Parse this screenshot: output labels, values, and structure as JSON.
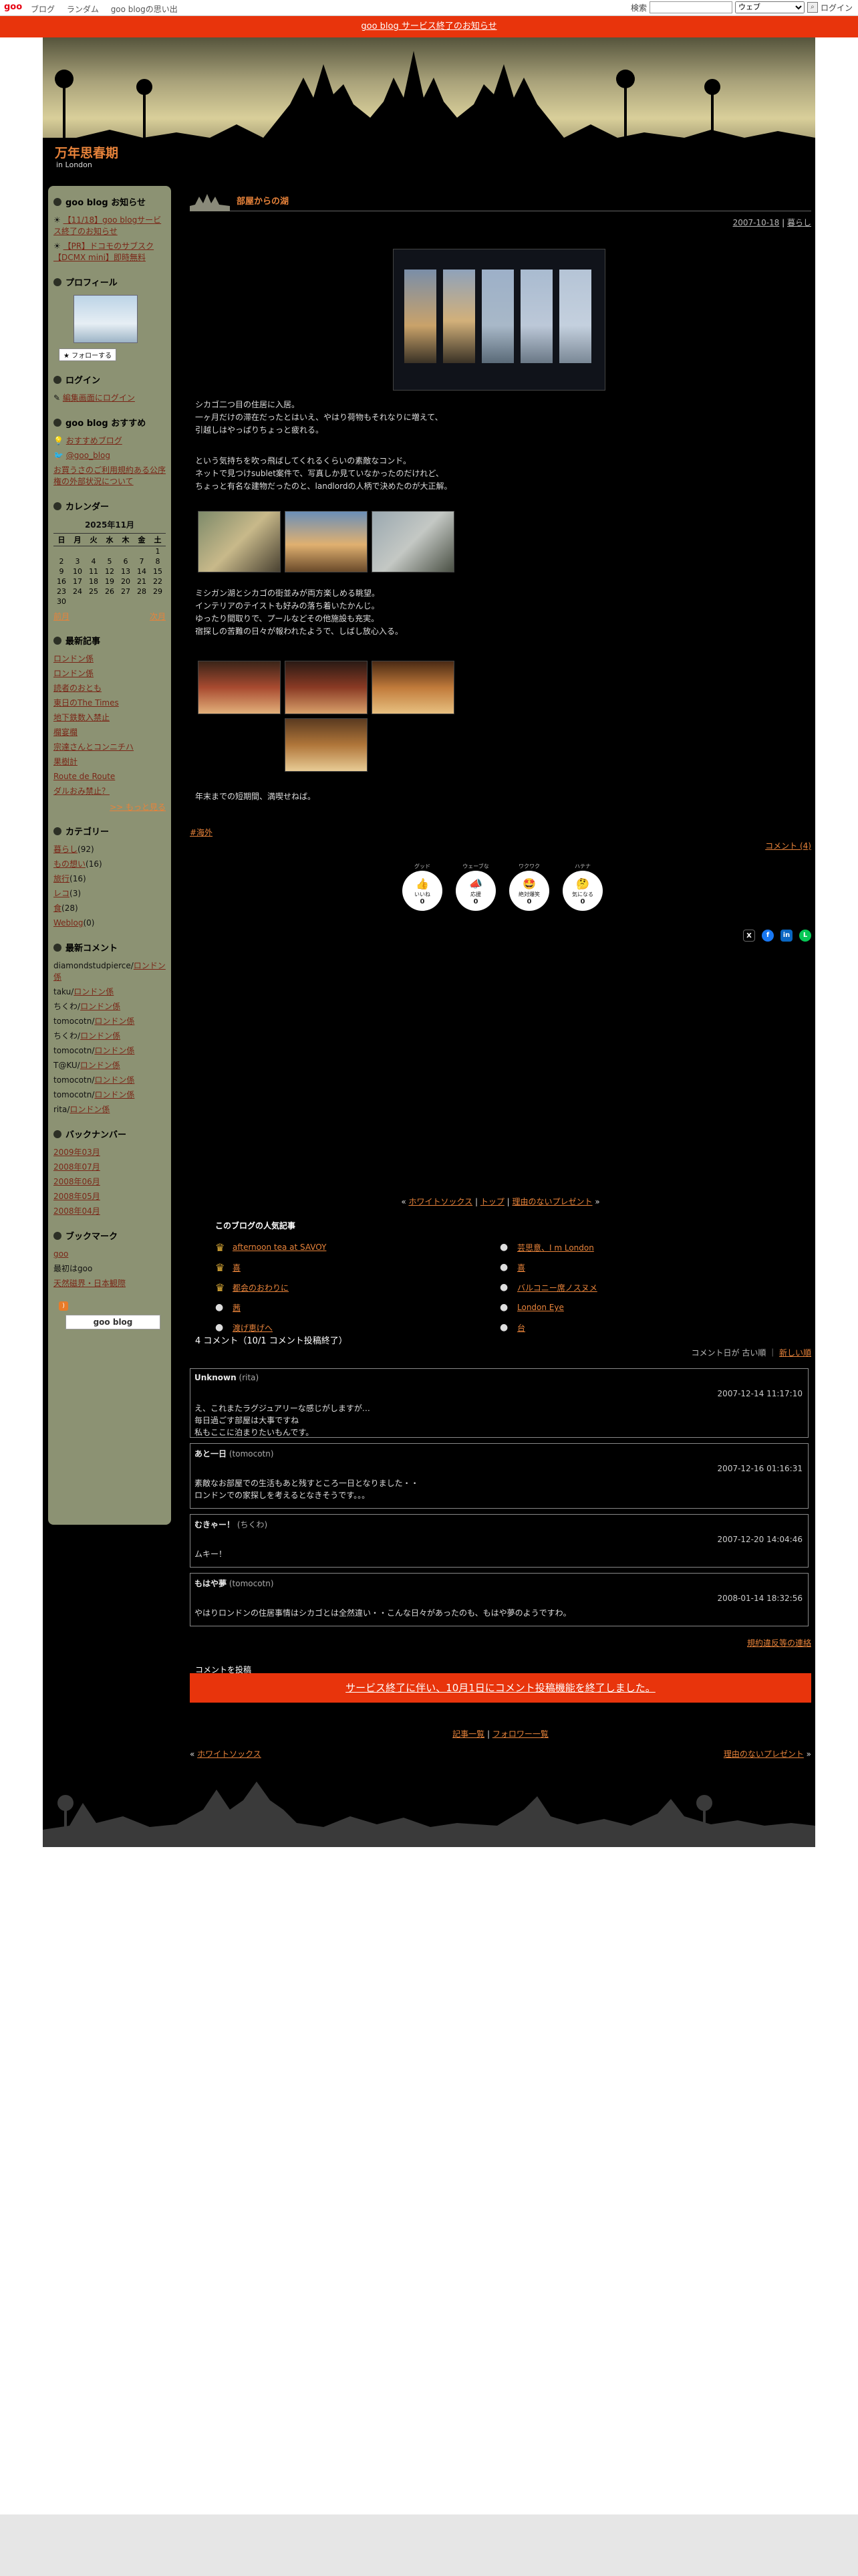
{
  "topbar": {
    "logo": "goo",
    "nav": [
      "ブログ",
      "ランダム",
      "goo blogの思い出"
    ],
    "search_label": "検索",
    "search_select": "ウェブ",
    "login": "ログイン"
  },
  "notice": "goo blog サービス終了のお知らせ",
  "blog": {
    "title": "万年思春期",
    "subtitle": "in London"
  },
  "sidebar": {
    "notice_h": "goo blog お知らせ",
    "notice_items": [
      "【11/18】goo blogサービス終了のお知らせ",
      "【PR】ドコモのサブスク【DCMX mini】即時無料"
    ],
    "profile_h": "プロフィール",
    "follow": "フォローする",
    "login_h": "ログイン",
    "login_link": "編集画面にログイン",
    "rec_h": "goo blog おすすめ",
    "rec_link": "おすすめブログ",
    "goo_blog_link": "@goo_blog",
    "rec_text": "お買うさのご利用規約ある公序権の外部状況について",
    "cal_h": "カレンダー",
    "cal_title": "2025年11月",
    "cal_days": [
      "日",
      "月",
      "火",
      "水",
      "木",
      "金",
      "土"
    ],
    "cal_rows": [
      [
        "",
        "",
        "",
        "",
        "",
        "",
        "1"
      ],
      [
        "2",
        "3",
        "4",
        "5",
        "6",
        "7",
        "8"
      ],
      [
        "9",
        "10",
        "11",
        "12",
        "13",
        "14",
        "15"
      ],
      [
        "16",
        "17",
        "18",
        "19",
        "20",
        "21",
        "22"
      ],
      [
        "23",
        "24",
        "25",
        "26",
        "27",
        "28",
        "29"
      ],
      [
        "30",
        "",
        "",
        "",
        "",
        "",
        ""
      ]
    ],
    "cal_prev": "前月",
    "cal_next": "次月",
    "recent_h": "最新記事",
    "recent_items": [
      "ロンドン係",
      "ロンドン係",
      "読者のおとも",
      "東日のThe Times",
      "地下鉄数入禁止",
      "欄宴欄",
      "宗達さんとコンニチハ",
      "果樹計",
      "Route de Route",
      "ダルおみ禁止？"
    ],
    "more": ">> もっと見る",
    "cat_h": "カテゴリー",
    "categories": [
      [
        "暮らし",
        "(92)"
      ],
      [
        "もの想い",
        "(16)"
      ],
      [
        "旅行",
        "(16)"
      ],
      [
        "レコ",
        "(3)"
      ],
      [
        "食",
        "(28)"
      ],
      [
        "Weblog",
        "(0)"
      ]
    ],
    "comments_h": "最新コメント",
    "comments": [
      [
        "diamondstudpierce",
        "ロンドン係"
      ],
      [
        "taku",
        "ロンドン係"
      ],
      [
        "ちくわ",
        "ロンドン係"
      ],
      [
        "tomocotn",
        "ロンドン係"
      ],
      [
        "ちくわ",
        "ロンドン係"
      ],
      [
        "tomocotn",
        "ロンドン係"
      ],
      [
        "T@KU",
        "ロンドン係"
      ],
      [
        "tomocotn",
        "ロンドン係"
      ],
      [
        "tomocotn",
        "ロンドン係"
      ],
      [
        "rita",
        "ロンドン係"
      ]
    ],
    "backnum_h": "バックナンバー",
    "backnums": [
      "2009年03月",
      "2008年07月",
      "2008年06月",
      "2008年05月",
      "2008年04月"
    ],
    "bookmark_h": "ブックマーク",
    "bookmarks": [
      "goo",
      "最初はgoo",
      "天然磁界・日本観際"
    ],
    "goo_badge": "goo blog"
  },
  "post": {
    "title": "部屋からの湖",
    "date": "2007-10-18",
    "category_link": "暮らし",
    "para1": "シカゴ二つ目の住居に入居。\n一ヶ月だけの滞在だったとはいえ、やはり荷物もそれなりに増えて、\n引越しはやっぱりちょっと疲れる。",
    "para2": "という気持ちを吹っ飛ばしてくれるくらいの素敵なコンド。\nネットで見つけsublet案件で、写真しか見ていなかったのだけれど、\nちょっと有名な建物だったのと、landlordの人柄で決めたのが大正解。",
    "para3": "ミシガン湖とシカゴの街並みが両方楽しめる眺望。\nインテリアのテイストも好みの落ち着いたかんじ。\nゆったり間取りで、プールなどその他施設も充実。\n宿探しの苦難の日々が報われたようで、しばし放心入る。",
    "para4": "年末までの短期間、満喫せねば。",
    "tag": "#海外",
    "comment_link": "コメント (4)",
    "reactions": [
      {
        "label": "グッド",
        "name": "いいね",
        "count": "0"
      },
      {
        "label": "ウェーブな",
        "name": "応援",
        "count": "0"
      },
      {
        "label": "ワクワク",
        "name": "絶対爆笑",
        "count": "0"
      },
      {
        "label": "ハテナ",
        "name": "気になる",
        "count": "0"
      }
    ],
    "nav_prev": "ホワイトソックス",
    "nav_top": "トップ",
    "nav_next": "理由のないプレゼント"
  },
  "popular": {
    "title": "このブログの人気記事",
    "left": [
      "afternoon tea at SAVOY",
      "喜",
      "都会のおわりに",
      "茜",
      "渡げ恵げへ"
    ],
    "right": [
      "芸思意、I m London",
      "喜",
      "バルコニー席ノスヌメ",
      "London Eye",
      "台"
    ]
  },
  "comments": {
    "header": "4 コメント（10/1 コメント投稿終了）",
    "sort": "コメント日が  古い順  ｜  ",
    "sort_new": "新しい順",
    "items": [
      {
        "name": "Unknown",
        "sub": "(rita)",
        "date": "2007-12-14 11:17:10",
        "body": "え、これまたラグジュアリーな感じがしますが…\n毎日過ごす部屋は大事ですね\n私もここに泊まりたいもんです。"
      },
      {
        "name": "あと一日",
        "sub": "(tomocotn)",
        "date": "2007-12-16 01:16:31",
        "body": "素敵なお部屋での生活もあと残すところ一日となりました・・\nロンドンでの家探しを考えるとなきそうです。。。"
      },
      {
        "name": "むきゃー！",
        "sub": "(ちくわ)",
        "date": "2007-12-20 14:04:46",
        "body": "ムキー！"
      },
      {
        "name": "もはや夢",
        "sub": "(tomocotn)",
        "date": "2008-01-14 18:32:56",
        "body": "やはりロンドンの住居事情はシカゴとは全然違い・・こんな日々があったのも、もはや夢のようですわ。"
      }
    ],
    "terms_link": "規約違反等の連絡",
    "post_label": "コメントを投稿",
    "ended_banner": "サービス終了に伴い、10月1日にコメント投稿機能を終了しました。",
    "list_link1": "記事一覧",
    "list_link2": "フォロワー一覧",
    "prev": "ホワイトソックス",
    "next": "理由のないプレゼント"
  },
  "colors": {
    "accent": "#e8833a",
    "notice_bg": "#e8340c",
    "sidebar_bg": "#8c9273",
    "page_bg": "#000000"
  }
}
